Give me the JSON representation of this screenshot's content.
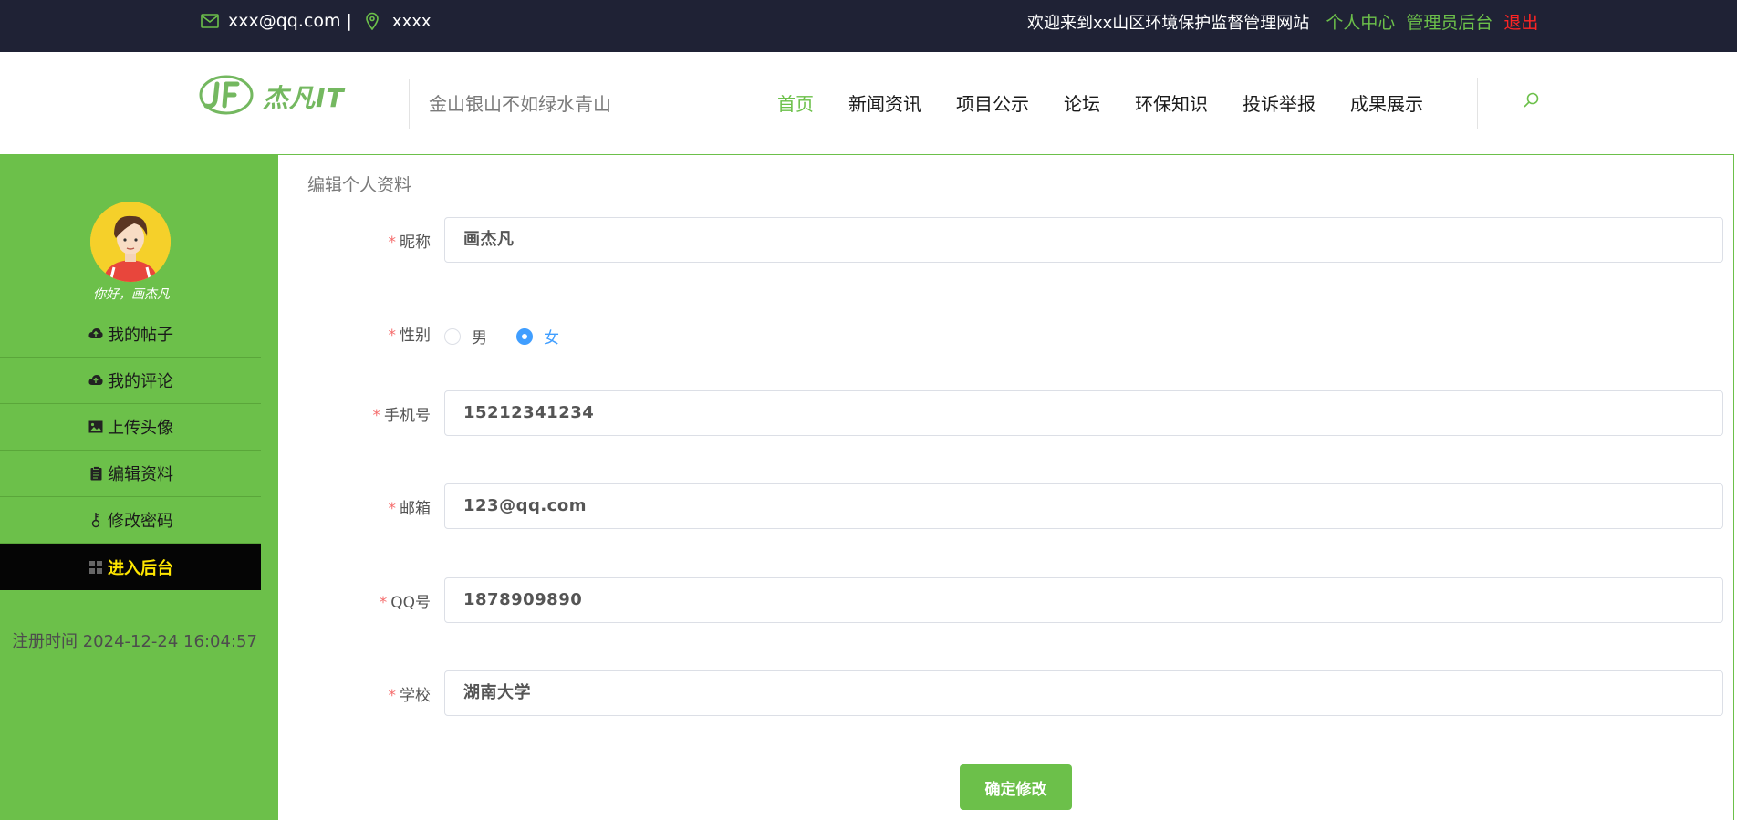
{
  "topbar": {
    "email": "xxx@qq.com |",
    "address": "xxxx",
    "welcome": "欢迎来到xx山区环境保护监督管理网站",
    "personal_center": "个人中心",
    "admin_backend": "管理员后台",
    "logout": "退出"
  },
  "header": {
    "brand": "杰凡IT",
    "slogan": "金山银山不如绿水青山",
    "nav": [
      "首页",
      "新闻资讯",
      "项目公示",
      "论坛",
      "环保知识",
      "投诉举报",
      "成果展示"
    ]
  },
  "sidebar": {
    "greeting": "你好，画杰凡",
    "menu": [
      "我的帖子",
      "我的评论",
      "上传头像",
      "编辑资料",
      "修改密码",
      "进入后台"
    ],
    "register_time": "注册时间 2024-12-24 16:04:57"
  },
  "form": {
    "title": "编辑个人资料",
    "required_mark": "*",
    "nickname_label": "昵称",
    "nickname_value": "画杰凡",
    "gender_label": "性别",
    "gender_male": "男",
    "gender_female": "女",
    "gender_selected": "女",
    "phone_label": "手机号",
    "phone_value": "15212341234",
    "email_label": "邮箱",
    "email_value": "123@qq.com",
    "qq_label": "QQ号",
    "qq_value": "1878909890",
    "school_label": "学校",
    "school_value": "湖南大学",
    "submit_label": "确定修改"
  },
  "colors": {
    "topbar_bg": "#1f2235",
    "accent_green": "#6cc04a",
    "logout_red": "#ff2424",
    "radio_blue": "#409eff",
    "dark_menu_text": "#ffe600"
  },
  "icons": [
    "mail-icon",
    "location-pin-icon",
    "search-icon",
    "cloud-upload-icon",
    "image-icon",
    "clipboard-icon",
    "key-icon",
    "grid-icon"
  ]
}
